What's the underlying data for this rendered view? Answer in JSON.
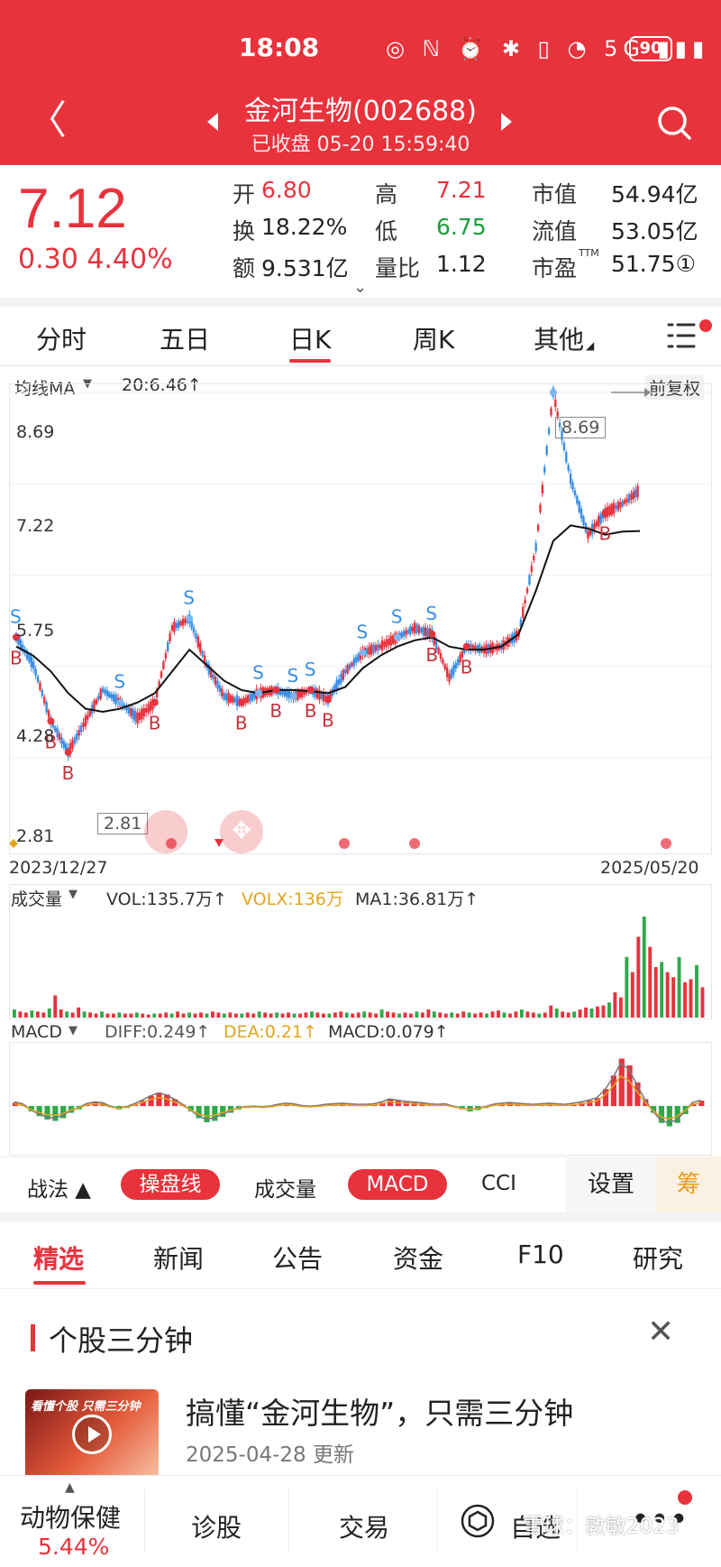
{
  "status_bar": {
    "time": "18:08",
    "icons": "◎ ℕ ⏰ ✱ ▯ ◔ 5G ▮▮▮",
    "battery": "90"
  },
  "header": {
    "title": "金河生物(002688)",
    "subtitle": "已收盘  05-20 15:59:40"
  },
  "quote": {
    "price": "7.12",
    "change": "0.30  4.40%",
    "open_label": "开",
    "open": "6.80",
    "high_label": "高",
    "high": "7.21",
    "mktcap_label": "市值",
    "mktcap": "54.94亿",
    "turnover_label": "换",
    "turnover": "18.22%",
    "low_label": "低",
    "low": "6.75",
    "float_label": "流值",
    "float": "53.05亿",
    "amount_label": "额",
    "amount": "9.531亿",
    "volratio_label": "量比",
    "volratio": "1.12",
    "pe_label": "市盈",
    "pe_sup": "TTM",
    "pe": "51.75①"
  },
  "period_tabs": [
    "分时",
    "五日",
    "日K",
    "周K",
    "其他"
  ],
  "active_period": "日K",
  "kline": {
    "ma_label": "均线MA",
    "ma_value": "20:6.46↑",
    "adjust": "前复权",
    "y_ticks": [
      "8.69",
      "7.22",
      "5.75",
      "4.28",
      "2.81"
    ],
    "date_start": "2023/12/27",
    "date_end": "2025/05/20",
    "max_label": "8.69",
    "min_label": "2.81",
    "colors": {
      "up": "#e8323c",
      "down": "#3a8ee6",
      "ma": "#111111"
    }
  },
  "chart_data": {
    "type": "line",
    "title": "",
    "x": [
      "2023/12/27",
      "",
      "",
      "",
      "",
      "",
      "",
      "",
      "",
      "",
      "",
      "",
      "",
      "",
      "",
      "",
      "",
      "",
      "",
      "",
      "",
      "",
      "",
      "",
      "",
      "",
      "",
      "",
      "",
      "",
      "",
      "2025/05/20"
    ],
    "series": [
      {
        "name": "",
        "values": [
          4.75,
          4.3,
          3.4,
          2.9,
          3.4,
          3.9,
          3.7,
          3.45,
          3.7,
          4.9,
          5.05,
          4.3,
          3.8,
          3.7,
          3.85,
          3.9,
          3.8,
          3.9,
          3.75,
          4.2,
          4.5,
          4.6,
          4.75,
          4.9,
          4.8,
          4.1,
          4.6,
          4.55,
          4.6,
          4.8,
          6.2,
          8.69,
          7.3,
          6.4,
          6.75,
          6.9,
          7.12
        ]
      },
      {
        "name": "MA",
        "values": [
          4.6,
          4.45,
          4.2,
          3.85,
          3.6,
          3.55,
          3.6,
          3.7,
          3.85,
          4.2,
          4.55,
          4.3,
          4.05,
          3.9,
          3.85,
          3.9,
          3.9,
          3.88,
          3.85,
          3.95,
          4.25,
          4.45,
          4.6,
          4.7,
          4.75,
          4.6,
          4.55,
          4.55,
          4.6,
          4.8,
          5.5,
          6.3,
          6.55,
          6.5,
          6.4,
          6.45,
          6.46
        ]
      }
    ],
    "ylim": [
      2.81,
      8.69
    ],
    "markers": [
      {
        "label": "S",
        "i": 0
      },
      {
        "label": "B",
        "i": 0
      },
      {
        "label": "B",
        "i": 2
      },
      {
        "label": "B",
        "i": 3
      },
      {
        "label": "S",
        "i": 6
      },
      {
        "label": "B",
        "i": 8
      },
      {
        "label": "S",
        "i": 10
      },
      {
        "label": "B",
        "i": 13
      },
      {
        "label": "S",
        "i": 14
      },
      {
        "label": "B",
        "i": 15
      },
      {
        "label": "S",
        "i": 16
      },
      {
        "label": "S",
        "i": 17
      },
      {
        "label": "B",
        "i": 17
      },
      {
        "label": "B",
        "i": 18
      },
      {
        "label": "S",
        "i": 20
      },
      {
        "label": "S",
        "i": 22
      },
      {
        "label": "S",
        "i": 24
      },
      {
        "label": "B",
        "i": 24
      },
      {
        "label": "B",
        "i": 26
      },
      {
        "label": "S",
        "i": 31
      },
      {
        "label": "B",
        "i": 34
      }
    ]
  },
  "volume": {
    "label": "成交量",
    "vol": "VOL:135.7万↑",
    "volx": "VOLX:136万",
    "ma1": "MA1:36.81万↑",
    "values": [
      8,
      6,
      5,
      7,
      6,
      5,
      9,
      22,
      8,
      6,
      5,
      10,
      6,
      5,
      4,
      6,
      4,
      4,
      5,
      4,
      4,
      5,
      4,
      3,
      4,
      4,
      5,
      4,
      6,
      4,
      5,
      4,
      5,
      4,
      6,
      5,
      4,
      5,
      4,
      4,
      5,
      4,
      6,
      5,
      4,
      5,
      4,
      5,
      4,
      4,
      5,
      6,
      5,
      4,
      4,
      5,
      6,
      5,
      4,
      5,
      6,
      5,
      4,
      8,
      6,
      5,
      4,
      5,
      4,
      6,
      5,
      8,
      6,
      5,
      4,
      5,
      4,
      6,
      5,
      4,
      5,
      4,
      6,
      7,
      5,
      4,
      6,
      8,
      6,
      5,
      4,
      5,
      12,
      9,
      6,
      5,
      6,
      8,
      10,
      9,
      11,
      12,
      15,
      25,
      20,
      60,
      45,
      80,
      100,
      70,
      50,
      55,
      45,
      40,
      60,
      35,
      38,
      52,
      30
    ]
  },
  "macd": {
    "label": "MACD",
    "diff": "DIFF:0.249↑",
    "dea": "DEA:0.21↑",
    "macd": "MACD:0.079↑",
    "values": [
      0.05,
      0.02,
      -0.08,
      -0.15,
      -0.2,
      -0.22,
      -0.18,
      -0.1,
      -0.05,
      0.02,
      0.05,
      0.04,
      -0.02,
      -0.05,
      -0.03,
      0.02,
      0.08,
      0.15,
      0.2,
      0.17,
      0.1,
      0.02,
      -0.08,
      -0.18,
      -0.24,
      -0.22,
      -0.16,
      -0.1,
      -0.05,
      -0.03,
      -0.02,
      -0.03,
      -0.02,
      0.01,
      0.03,
      0.02,
      -0.01,
      -0.02,
      -0.01,
      0.01,
      0.02,
      0.03,
      0.02,
      0.01,
      0.01,
      0.02,
      0.05,
      0.1,
      0.08,
      0.06,
      0.05,
      0.04,
      0.02,
      0.01,
      0.02,
      -0.02,
      -0.05,
      -0.08,
      -0.06,
      -0.03,
      0.01,
      0.03,
      0.04,
      0.03,
      0.02,
      0.01,
      0.02,
      0.03,
      0.02,
      0.01,
      0.03,
      0.05,
      0.08,
      0.12,
      0.25,
      0.45,
      0.7,
      0.6,
      0.35,
      0.1,
      -0.1,
      -0.25,
      -0.3,
      -0.25,
      -0.12,
      0.04,
      0.079
    ]
  },
  "indicator_tabs": {
    "zhanfa": "战法 ▲",
    "caopan": "操盘线",
    "volume": "成交量",
    "macd": "MACD",
    "cci": "CCI",
    "settings": "设置",
    "chip": "筹"
  },
  "news_tabs": [
    "精选",
    "新闻",
    "公告",
    "资金",
    "F10",
    "研究"
  ],
  "news": {
    "section": "个股三分钟",
    "headline": "搞懂“金河生物”，只需三分钟",
    "date": "2025-04-28 更新",
    "thumb_caption": "看懂个股 只需三分钟"
  },
  "bottom_nav": {
    "sector": "动物保健",
    "sector_pct": "5.44%",
    "diagnose": "诊股",
    "trade": "交易",
    "watch": "自选",
    "watermark": "雪球：敦敏2023"
  }
}
